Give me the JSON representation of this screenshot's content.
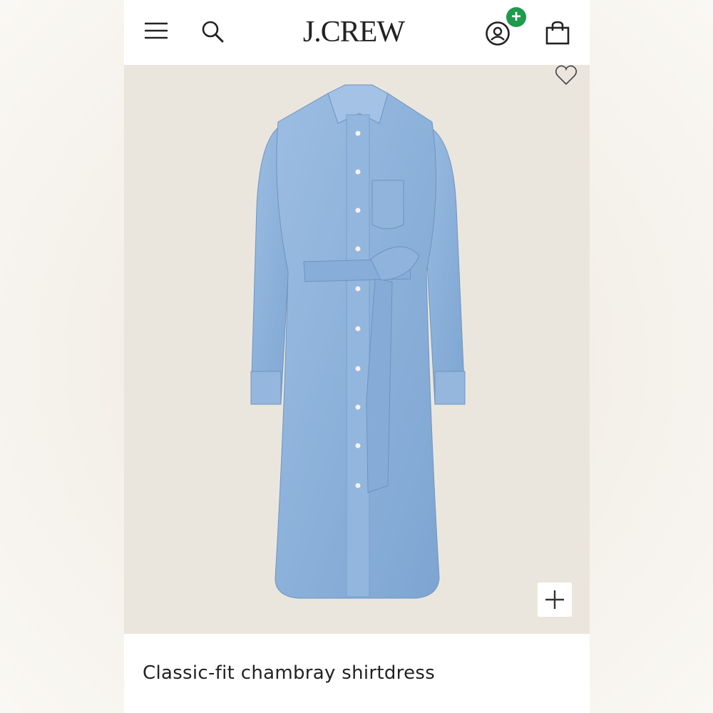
{
  "brand": {
    "logo_text": "J.CREW"
  },
  "header": {
    "menu_icon": "hamburger-menu-icon",
    "search_icon": "search-icon",
    "account_icon": "account-icon",
    "account_badge": "+",
    "badge_color": "#1e9b4c",
    "bag_icon": "shopping-bag-icon"
  },
  "product": {
    "name": "Classic-fit chambray shirtdress",
    "favorite_icon": "heart-outline-icon",
    "zoom_icon": "plus-icon",
    "image_background": "#ebe6dd",
    "dress_color": "#8cb1da"
  }
}
